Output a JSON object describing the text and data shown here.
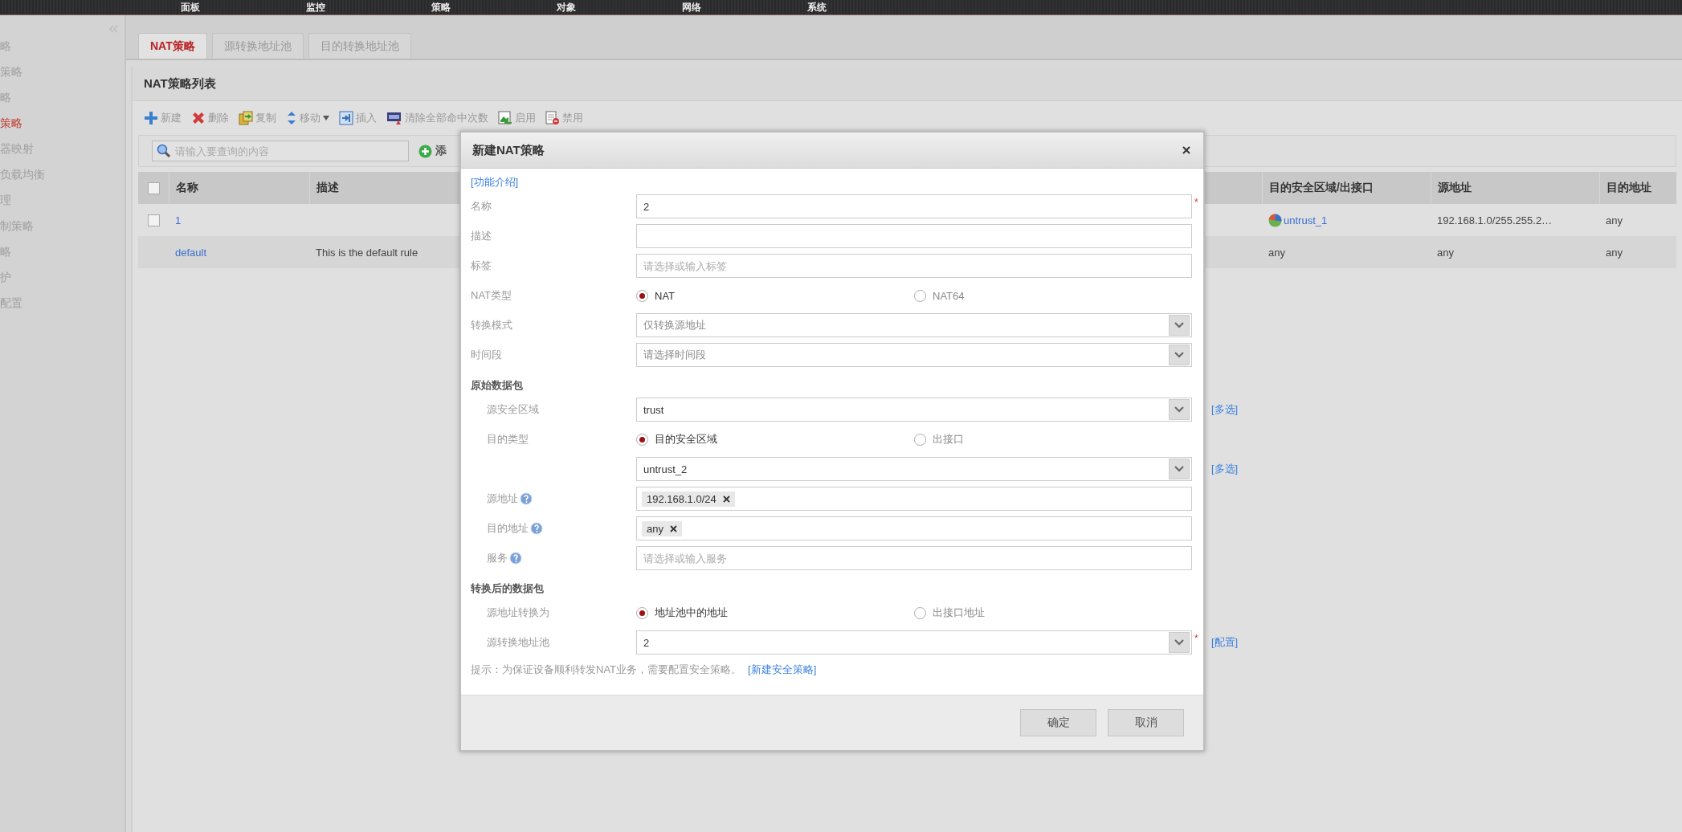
{
  "top_nav": [
    {
      "label": "面板"
    },
    {
      "label": "监控"
    },
    {
      "label": "策略"
    },
    {
      "label": "对象"
    },
    {
      "label": "网络"
    },
    {
      "label": "系统"
    }
  ],
  "sidebar": {
    "items": [
      {
        "label": "略",
        "selected": false
      },
      {
        "label": "策略",
        "selected": false
      },
      {
        "label": "略",
        "selected": false
      },
      {
        "label": "策略",
        "selected": true
      },
      {
        "label": "器映射",
        "selected": false
      },
      {
        "label": "负载均衡",
        "selected": false
      },
      {
        "label": "理",
        "selected": false
      },
      {
        "label": "制策略",
        "selected": false
      },
      {
        "label": "略",
        "selected": false
      },
      {
        "label": "护",
        "selected": false
      },
      {
        "label": "配置",
        "selected": false
      }
    ]
  },
  "tabs": [
    {
      "label": "NAT策略",
      "selected": true
    },
    {
      "label": "源转换地址池",
      "selected": false
    },
    {
      "label": "目的转换地址池",
      "selected": false
    }
  ],
  "panel": {
    "title": "NAT策略列表",
    "toolbar": [
      {
        "label": "新建",
        "kind": "add",
        "has_menu": false
      },
      {
        "label": "删除",
        "kind": "delete",
        "has_menu": false
      },
      {
        "label": "复制",
        "kind": "copy",
        "has_menu": false
      },
      {
        "label": "移动",
        "kind": "move",
        "has_menu": true
      },
      {
        "label": "插入",
        "kind": "insert",
        "has_menu": false
      },
      {
        "label": "清除全部命中次数",
        "kind": "clear",
        "has_menu": false
      },
      {
        "label": "启用",
        "kind": "enable",
        "has_menu": false
      },
      {
        "label": "禁用",
        "kind": "disable",
        "has_menu": false
      }
    ],
    "search": {
      "placeholder": "请输入要查询的内容"
    },
    "add_button": "添",
    "table": {
      "header_checked": false,
      "columns": [
        "名称",
        "描述",
        "目的安全区域/出接口",
        "源地址",
        "目的地址"
      ],
      "rows": [
        {
          "checked": false,
          "name": "1",
          "dest_zone": {
            "text": "untrust_1",
            "kind": "zone"
          },
          "source": "192.168.1.0/255.255.2…",
          "destination": "any"
        },
        {
          "name": "default",
          "description": "This is the default rule",
          "dest_zone": {
            "text": "any",
            "kind": "plain"
          },
          "source": "any",
          "destination": "any"
        }
      ]
    }
  },
  "dialog": {
    "title": "新建NAT策略",
    "help_link": "[功能介绍]",
    "groups": [
      {
        "fields": [
          {
            "kind": "text",
            "label": "名称",
            "value": "2",
            "required_mark": "*"
          },
          {
            "kind": "text",
            "label": "描述"
          },
          {
            "kind": "text",
            "label": "标签",
            "placeholder": "请选择或输入标签"
          },
          {
            "kind": "radio",
            "label": "NAT类型",
            "options": [
              {
                "label": "NAT",
                "selected": true
              },
              {
                "label": "NAT64",
                "selected": false
              }
            ]
          },
          {
            "kind": "select",
            "label": "转换模式",
            "placeholder": "仅转换源地址"
          },
          {
            "kind": "select",
            "label": "时间段",
            "placeholder": "请选择时间段"
          }
        ]
      },
      {
        "heading": "原始数据包",
        "fields": [
          {
            "kind": "select",
            "label": "源安全区域",
            "value": "trust",
            "side_link": "[多选]"
          },
          {
            "kind": "radio",
            "label": "目的类型",
            "options": [
              {
                "label": "目的安全区域",
                "selected": true
              },
              {
                "label": "出接口",
                "selected": false
              }
            ]
          },
          {
            "kind": "select",
            "value": "untrust_2",
            "side_link": "[多选]"
          },
          {
            "kind": "tags",
            "label": "源地址",
            "tags": [
              "192.168.1.0/24"
            ],
            "help": true
          },
          {
            "kind": "tags",
            "label": "目的地址",
            "tags": [
              "any"
            ],
            "help": true
          },
          {
            "kind": "text",
            "label": "服务",
            "placeholder": "请选择或输入服务",
            "help": true
          }
        ]
      },
      {
        "heading": "转换后的数据包",
        "fields": [
          {
            "kind": "radio",
            "label": "源地址转换为",
            "options": [
              {
                "label": "地址池中的地址",
                "selected": true
              },
              {
                "label": "出接口地址",
                "selected": false
              }
            ]
          },
          {
            "kind": "select",
            "label": "源转换地址池",
            "value": "2",
            "required_mark": "*",
            "side_link": "[配置]"
          }
        ]
      }
    ],
    "hint": "提示：为保证设备顺利转发NAT业务，需要配置安全策略。",
    "hint_link": "[新建安全策略]",
    "buttons": [
      "确定",
      "取消"
    ]
  }
}
